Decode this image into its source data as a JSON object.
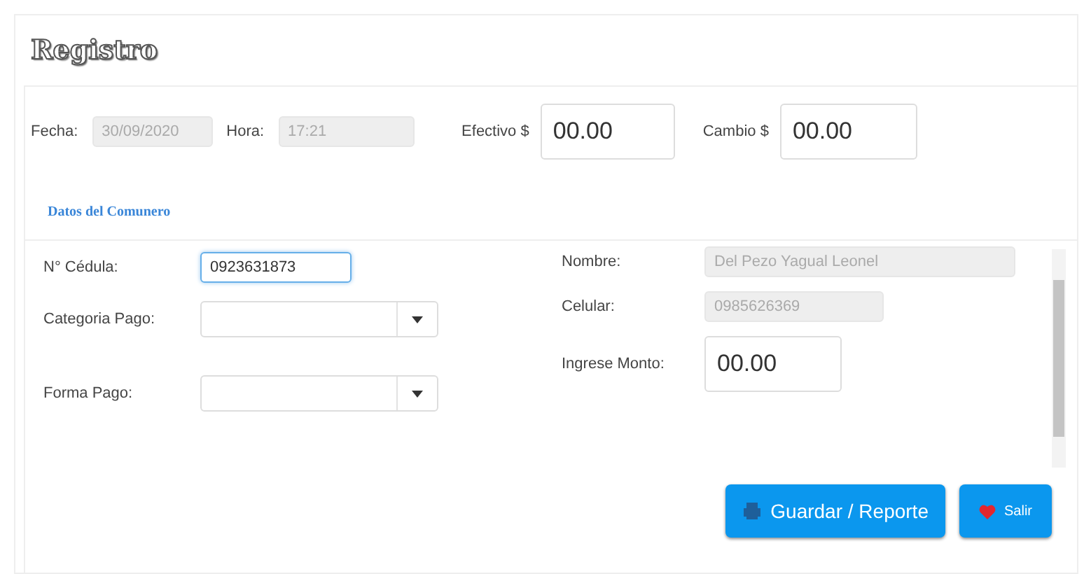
{
  "title": "Registro",
  "header_fields": [
    {
      "label": "Fecha:",
      "value": "30/09/2020",
      "disabled": true
    },
    {
      "label": "Hora:",
      "value": "17:21",
      "disabled": true
    },
    {
      "label": "Efectivo $",
      "value": "00.00",
      "disabled": false
    },
    {
      "label": "Cambio $",
      "value": "00.00",
      "disabled": false
    }
  ],
  "section_title": "Datos del Comunero",
  "left_fields": [
    {
      "kind": "text",
      "label": "N° Cédula:",
      "value": "0923631873",
      "focused": true
    },
    {
      "kind": "select",
      "label": "Categoria Pago:",
      "focused": false
    },
    {
      "kind": "select",
      "label": "Forma Pago:",
      "focused": false
    }
  ],
  "right_fields": [
    {
      "label": "Nombre:",
      "value": "Del Pezo Yagual Leonel",
      "disabled": true
    },
    {
      "label": "Celular:",
      "value": "0985626369",
      "disabled": true
    },
    {
      "label": "Ingrese Monto:",
      "value": "00.00",
      "disabled": false
    }
  ],
  "buttons": [
    {
      "label": "Guardar / Reporte",
      "kind": "save"
    },
    {
      "label": "Salir",
      "kind": "exit"
    }
  ]
}
